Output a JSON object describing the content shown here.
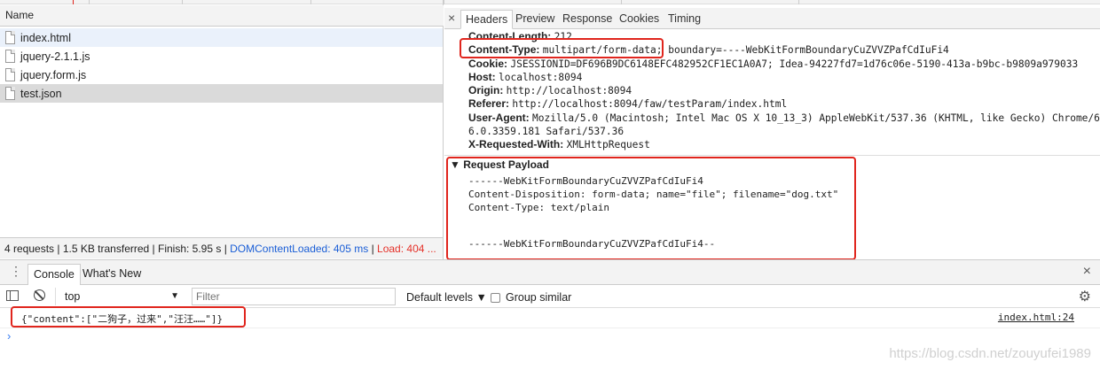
{
  "network": {
    "name_header": "Name",
    "requests": [
      "index.html",
      "jquery-2.1.1.js",
      "jquery.form.js",
      "test.json"
    ],
    "status": {
      "summary": "4 requests | 1.5 KB transferred | Finish: 5.95 s | ",
      "dom_loaded": "DOMContentLoaded: 405 ms",
      "sep": " | ",
      "load": "Load: 404 ..."
    }
  },
  "detail": {
    "close": "×",
    "tabs": [
      "Headers",
      "Preview",
      "Response",
      "Cookies",
      "Timing"
    ],
    "headers": [
      {
        "name": "Content-Length:",
        "value": "212"
      },
      {
        "name": "Content-Type:",
        "value": "multipart/form-data; boundary=----WebKitFormBoundaryCuZVVZPafCdIuFi4"
      },
      {
        "name": "Cookie:",
        "value": "JSESSIONID=DF696B9DC6148EFC482952CF1EC1A0A7; Idea-94227fd7=1d76c06e-5190-413a-b9bc-b9809a979033"
      },
      {
        "name": "Host:",
        "value": "localhost:8094"
      },
      {
        "name": "Origin:",
        "value": "http://localhost:8094"
      },
      {
        "name": "Referer:",
        "value": "http://localhost:8094/faw/testParam/index.html"
      },
      {
        "name": "User-Agent:",
        "value": "Mozilla/5.0 (Macintosh; Intel Mac OS X 10_13_3) AppleWebKit/537.36 (KHTML, like Gecko) Chrome/6"
      },
      {
        "name": "",
        "value": "6.0.3359.181 Safari/537.36"
      },
      {
        "name": "X-Requested-With:",
        "value": "XMLHttpRequest"
      }
    ],
    "payload_title": "▼ Request Payload",
    "payload_lines": [
      "------WebKitFormBoundaryCuZVVZPafCdIuFi4",
      "Content-Disposition: form-data; name=\"file\"; filename=\"dog.txt\"",
      "Content-Type: text/plain",
      "",
      "",
      "------WebKitFormBoundaryCuZVVZPafCdIuFi4--"
    ],
    "highlight_color": "#e0251d"
  },
  "console": {
    "kebab": "⋮",
    "tabs": [
      "Console",
      "What's New"
    ],
    "close": "×",
    "context": "top",
    "context_arrow": "▼",
    "filter_placeholder": "Filter",
    "levels": "Default levels ▼",
    "group_similar": "Group similar",
    "gear": "⚙",
    "message": "{\"content\":[\"二狗子，过来\",\"汪汪……\"]}",
    "source": "index.html:24",
    "prompt": "›"
  },
  "watermark": "https://blog.csdn.net/zouyufei1989",
  "colors": {
    "link_blue": "#1a5ed6",
    "load_red": "#e5322a",
    "prompt_blue": "#367cf1"
  }
}
